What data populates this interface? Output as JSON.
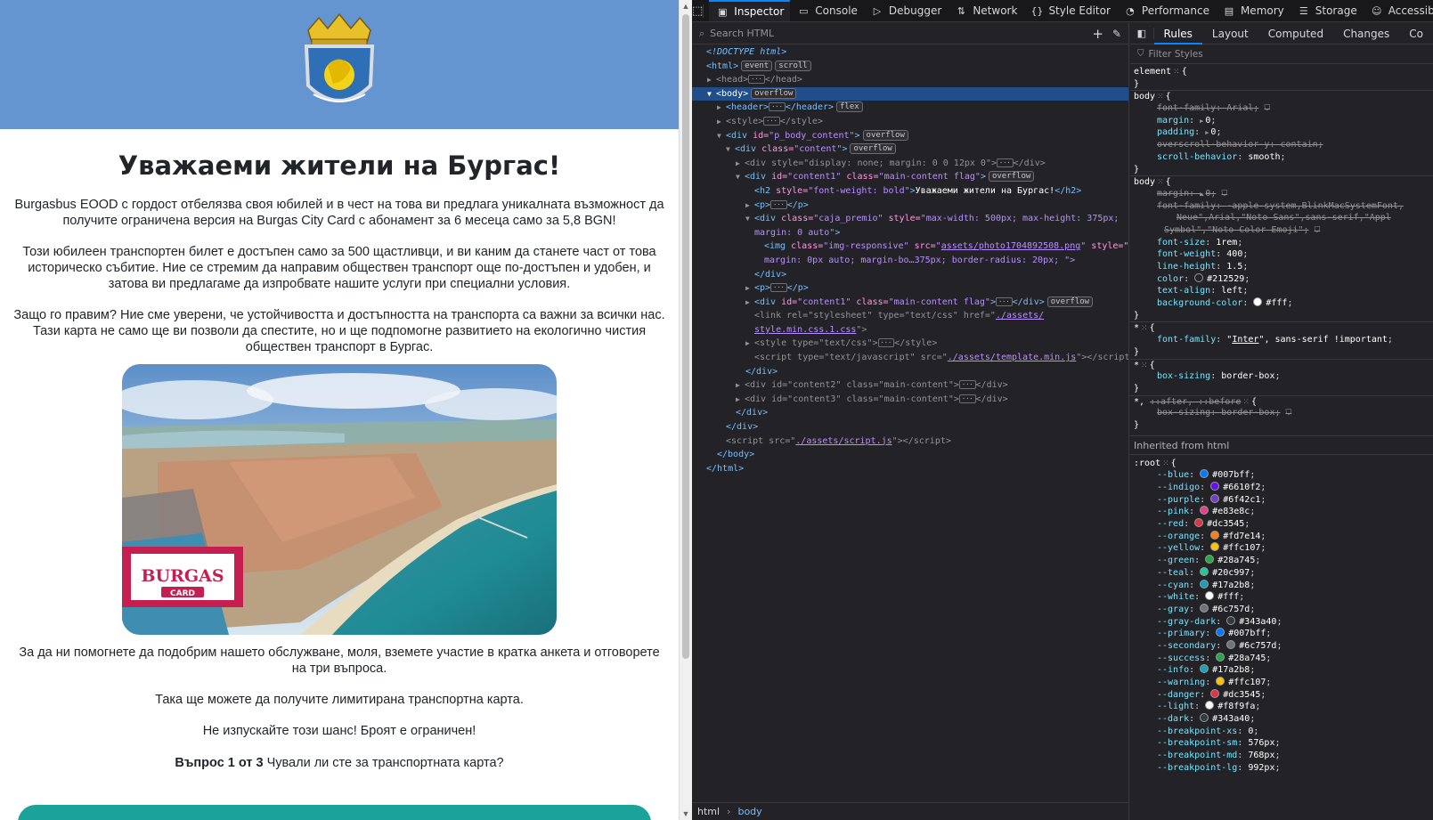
{
  "page": {
    "title": "Уважаеми жители на Бургас!",
    "paragraph1": "Burgasbus EOOD с гордост отбелязва своя юбилей и в чест на това ви предлага уникалната възможност да получите ограничена версия на Burgas City Card с абонамент за 6 месеца само за 5,8 BGN!",
    "paragraph2": "Този юбилеен транспортен билет е достъпен само за 500 щастливци, и ви каним да станете част от това историческо събитие. Ние се стремим да направим обществен транспорт още по-достъпен и удобен, и затова ви предлагаме да изпробвате нашите услуги при специални условия.",
    "paragraph3": "Защо го правим? Ние сме уверени, че устойчивостта и достъпността на транспорта са важни за всички нас. Тази карта не само ще ви позволи да спестите, но и ще подпомогне развитието на екологично чистия обществен транспорт в Бургас.",
    "paragraph4": "За да ни помогнете да подобрим нашето обслужване, моля, вземете участие в кратка анкета и отговорете на три въпроса.",
    "paragraph5": "Така ще можете да получите лимитирана транспортна карта.",
    "paragraph6": "Не изпускайте този шанс! Броят е ограничен!",
    "question_counter": "Въпрос 1 от 3",
    "question_text": " Чували ли сте за транспортната карта?",
    "card_logo_line1": "BURGAS",
    "card_logo_line2": "CARD",
    "header_color": "#6495d1",
    "button_color": "#1aa39a"
  },
  "devtools": {
    "tabs": [
      {
        "label": "Inspector",
        "icon": "inspector-icon"
      },
      {
        "label": "Console",
        "icon": "console-icon"
      },
      {
        "label": "Debugger",
        "icon": "debugger-icon"
      },
      {
        "label": "Network",
        "icon": "network-icon"
      },
      {
        "label": "Style Editor",
        "icon": "style-editor-icon"
      },
      {
        "label": "Performance",
        "icon": "performance-icon"
      },
      {
        "label": "Memory",
        "icon": "memory-icon"
      },
      {
        "label": "Storage",
        "icon": "storage-icon"
      },
      {
        "label": "Accessib",
        "icon": "accessibility-icon"
      }
    ],
    "search_placeholder": "Search HTML",
    "tree": {
      "doctype": "<!DOCTYPE html>",
      "html_open": "<html>",
      "html_badge1": "event",
      "html_badge2": "scroll",
      "head": "<head>",
      "head_close": "</head>",
      "body_open": "<body>",
      "body_badge": "overflow",
      "header_tag": "<header>",
      "header_close": "</header>",
      "header_badge": "flex",
      "style_tag": "<style>",
      "style_close": "</style>",
      "pbody_attr": "id=",
      "pbody_val": "\"p_body_content\"",
      "pbody_badge": "overflow",
      "content_attr": "class=",
      "content_val": "\"content\"",
      "content_badge": "overflow",
      "hidden_div": "style=\"display: none; margin: 0 0 12px 0\"",
      "content1_id": "\"content1\"",
      "content1_class": "\"main-content flag\"",
      "content1_badge": "overflow",
      "h2_style": "\"font-weight: bold\"",
      "h2_text": "Уважаеми жители на Бургас!",
      "caja_class": "\"caja_premio\"",
      "caja_style": "\"max-width: 500px; max-height: 375px;",
      "caja_style2": "margin: 0 auto\"",
      "img_class": "\"img-responsive\"",
      "img_src": "assets/photo1704892508.png",
      "img_style": "margin: 0px auto; margin-bo…375px; border-radius: 20px; \">",
      "link_rel": "\"stylesheet\"",
      "link_type": "\"text/css\"",
      "link_href1": "./assets/",
      "link_href2": "style.min.css.1.css",
      "style_type": "\"text/css\"",
      "script_type": "\"text/javascript\"",
      "script_src": "./assets/template.min.js",
      "content2": "\"content2\"",
      "content3": "\"content3\"",
      "main_content": "\"main-content\"",
      "script2_src": "./assets/script.js"
    },
    "breadcrumb": [
      "html",
      "body"
    ],
    "rules_tabs": [
      "Rules",
      "Layout",
      "Computed",
      "Changes",
      "Co"
    ],
    "filter_placeholder": "Filter Styles",
    "inherited_label": "Inherited from html",
    "root_vars": [
      {
        "name": "--blue",
        "value": "#007bff"
      },
      {
        "name": "--indigo",
        "value": "#6610f2"
      },
      {
        "name": "--purple",
        "value": "#6f42c1"
      },
      {
        "name": "--pink",
        "value": "#e83e8c"
      },
      {
        "name": "--red",
        "value": "#dc3545"
      },
      {
        "name": "--orange",
        "value": "#fd7e14"
      },
      {
        "name": "--yellow",
        "value": "#ffc107"
      },
      {
        "name": "--green",
        "value": "#28a745"
      },
      {
        "name": "--teal",
        "value": "#20c997"
      },
      {
        "name": "--cyan",
        "value": "#17a2b8"
      },
      {
        "name": "--white",
        "value": "#fff"
      },
      {
        "name": "--gray",
        "value": "#6c757d"
      },
      {
        "name": "--gray-dark",
        "value": "#343a40"
      },
      {
        "name": "--primary",
        "value": "#007bff"
      },
      {
        "name": "--secondary",
        "value": "#6c757d"
      },
      {
        "name": "--success",
        "value": "#28a745"
      },
      {
        "name": "--info",
        "value": "#17a2b8"
      },
      {
        "name": "--warning",
        "value": "#ffc107"
      },
      {
        "name": "--danger",
        "value": "#dc3545"
      },
      {
        "name": "--light",
        "value": "#f8f9fa"
      },
      {
        "name": "--dark",
        "value": "#343a40"
      }
    ],
    "root_extra": [
      {
        "name": "--breakpoint-xs",
        "value": "0"
      },
      {
        "name": "--breakpoint-sm",
        "value": "576px"
      },
      {
        "name": "--breakpoint-md",
        "value": "768px"
      },
      {
        "name": "--breakpoint-lg",
        "value": "992px"
      }
    ]
  }
}
